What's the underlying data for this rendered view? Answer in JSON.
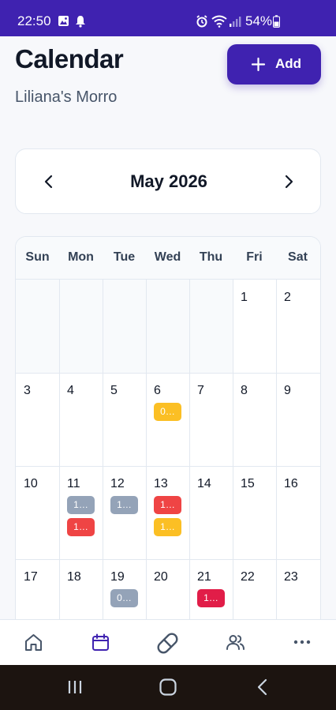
{
  "status_bar": {
    "time": "22:50",
    "battery_percent": "54%",
    "background_color": "#3f22b0"
  },
  "header": {
    "title": "Calendar",
    "subtitle": "Liliana's Morro",
    "add_label": "Add",
    "accent_color": "#3f22b0"
  },
  "month_nav": {
    "month_label": "May 2026",
    "prev_icon": "chevron-left-icon",
    "next_icon": "chevron-right-icon"
  },
  "weekdays": [
    "Sun",
    "Mon",
    "Tue",
    "Wed",
    "Thu",
    "Fri",
    "Sat"
  ],
  "weeks": [
    [
      null,
      null,
      null,
      null,
      null,
      {
        "day": "1",
        "events": []
      },
      {
        "day": "2",
        "events": []
      }
    ],
    [
      {
        "day": "3",
        "events": []
      },
      {
        "day": "4",
        "events": []
      },
      {
        "day": "5",
        "events": []
      },
      {
        "day": "6",
        "events": [
          {
            "label": "0…",
            "color": "#fbbf24"
          }
        ]
      },
      {
        "day": "7",
        "events": []
      },
      {
        "day": "8",
        "events": []
      },
      {
        "day": "9",
        "events": []
      }
    ],
    [
      {
        "day": "10",
        "events": []
      },
      {
        "day": "11",
        "events": [
          {
            "label": "1…",
            "color": "#94a3b8"
          },
          {
            "label": "1…",
            "color": "#ef4444"
          }
        ]
      },
      {
        "day": "12",
        "events": [
          {
            "label": "1…",
            "color": "#94a3b8"
          }
        ]
      },
      {
        "day": "13",
        "events": [
          {
            "label": "1…",
            "color": "#ef4444"
          },
          {
            "label": "1…",
            "color": "#fbbf24"
          }
        ]
      },
      {
        "day": "14",
        "events": []
      },
      {
        "day": "15",
        "events": []
      },
      {
        "day": "16",
        "events": []
      }
    ],
    [
      {
        "day": "17",
        "events": []
      },
      {
        "day": "18",
        "events": []
      },
      {
        "day": "19",
        "events": [
          {
            "label": "0…",
            "color": "#94a3b8"
          }
        ]
      },
      {
        "day": "20",
        "events": []
      },
      {
        "day": "21",
        "events": [
          {
            "label": "1…",
            "color": "#e11d48"
          }
        ]
      },
      {
        "day": "22",
        "events": []
      },
      {
        "day": "23",
        "events": []
      }
    ]
  ],
  "bottom_nav": [
    {
      "id": "home",
      "icon": "home-icon",
      "active": false
    },
    {
      "id": "calendar",
      "icon": "calendar-icon",
      "active": true
    },
    {
      "id": "medications",
      "icon": "pill-icon",
      "active": false
    },
    {
      "id": "people",
      "icon": "users-icon",
      "active": false
    },
    {
      "id": "more",
      "icon": "more-icon",
      "active": false
    }
  ],
  "system_nav": [
    "recents-icon",
    "home-circle-icon",
    "back-icon"
  ]
}
